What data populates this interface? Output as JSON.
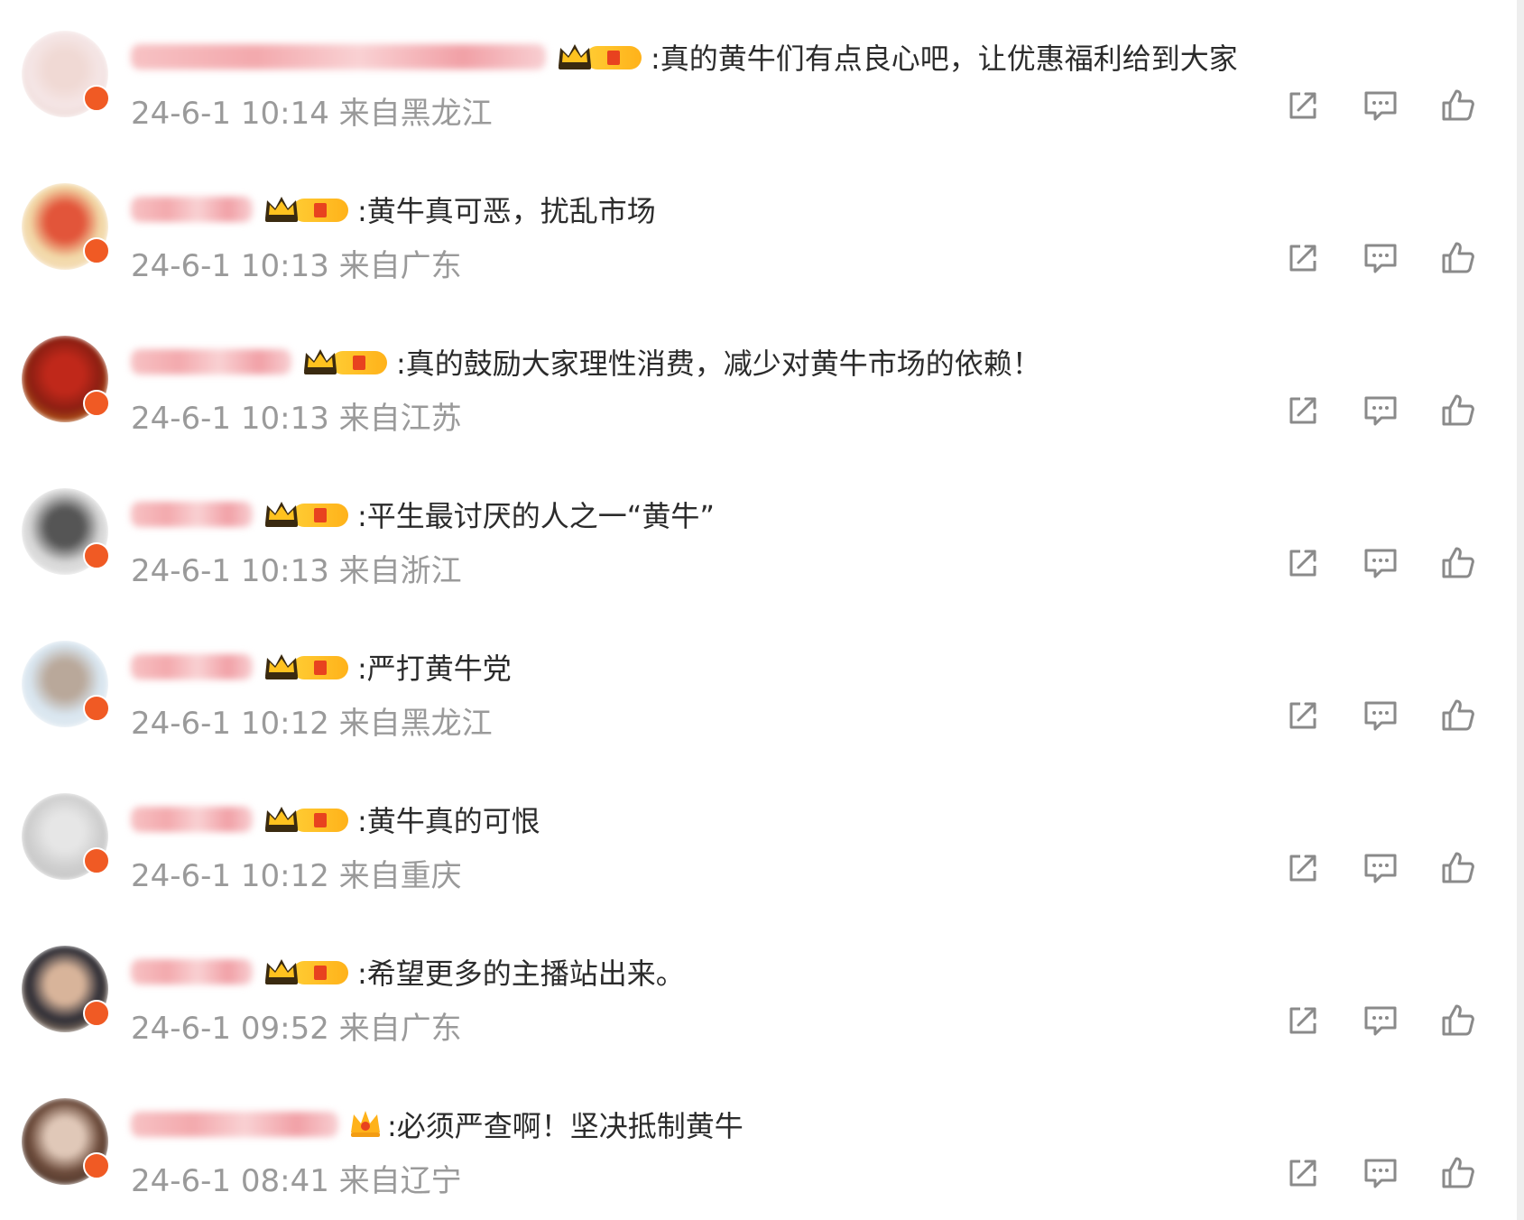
{
  "comments": [
    {
      "avatar_colors": [
        "#f5e6e6",
        "#f0d9d4",
        "#e8d2cc"
      ],
      "username_width": 460,
      "badge": "crown-vip",
      "text": ":真的黄牛们有点良心吧，让优惠福利给到大家",
      "meta": "24-6-1 10:14 来自黑龙江"
    },
    {
      "avatar_colors": [
        "#f2d9a8",
        "#e2553a",
        "#f7e0c8"
      ],
      "username_width": 135,
      "badge": "crown-vip",
      "text": ":黄牛真可恶，扰乱市场",
      "meta": "24-6-1 10:13 来自广东"
    },
    {
      "avatar_colors": [
        "#8b1e12",
        "#c0281a",
        "#e0a020"
      ],
      "username_width": 178,
      "badge": "crown-vip",
      "text": ":真的鼓励大家理性消费，减少对黄牛市场的依赖！",
      "meta": "24-6-1 10:13 来自江苏"
    },
    {
      "avatar_colors": [
        "#d7d7d7",
        "#555555",
        "#eeeeee"
      ],
      "username_width": 135,
      "badge": "crown-vip",
      "text": ":平生最讨厌的人之一“黄牛”",
      "meta": "24-6-1 10:13 来自浙江"
    },
    {
      "avatar_colors": [
        "#d9e6f0",
        "#b9a89a",
        "#e8eef2"
      ],
      "username_width": 135,
      "badge": "crown-vip",
      "text": ":严打黄牛党",
      "meta": "24-6-1 10:12 来自黑龙江"
    },
    {
      "avatar_colors": [
        "#cfcfcf",
        "#e6e6e6",
        "#bdbdbd"
      ],
      "username_width": 135,
      "badge": "crown-vip",
      "text": ":黄牛真的可恨",
      "meta": "24-6-1 10:12 来自重庆"
    },
    {
      "avatar_colors": [
        "#2a2a33",
        "#d8b49a",
        "#f0c89a"
      ],
      "username_width": 135,
      "badge": "crown-vip",
      "text": ":希望更多的主播站出来。",
      "meta": "24-6-1 09:52 来自广东"
    },
    {
      "avatar_colors": [
        "#6b4a3a",
        "#e0c8b8",
        "#3a2a22"
      ],
      "username_width": 230,
      "badge": "small-crown",
      "text": ":必须严查啊！坚决抵制黄牛",
      "meta": "24-6-1 08:41 来自辽宁"
    }
  ],
  "actions": {
    "share_icon": "share-icon",
    "comment_icon": "comment-icon",
    "like_icon": "thumbs-up-icon"
  },
  "colors": {
    "text": "#2b2b2b",
    "meta": "#9a9a9a",
    "icon": "#8a8a8a",
    "vip_gold": "#ffb21a",
    "accent_red": "#e8421f"
  }
}
